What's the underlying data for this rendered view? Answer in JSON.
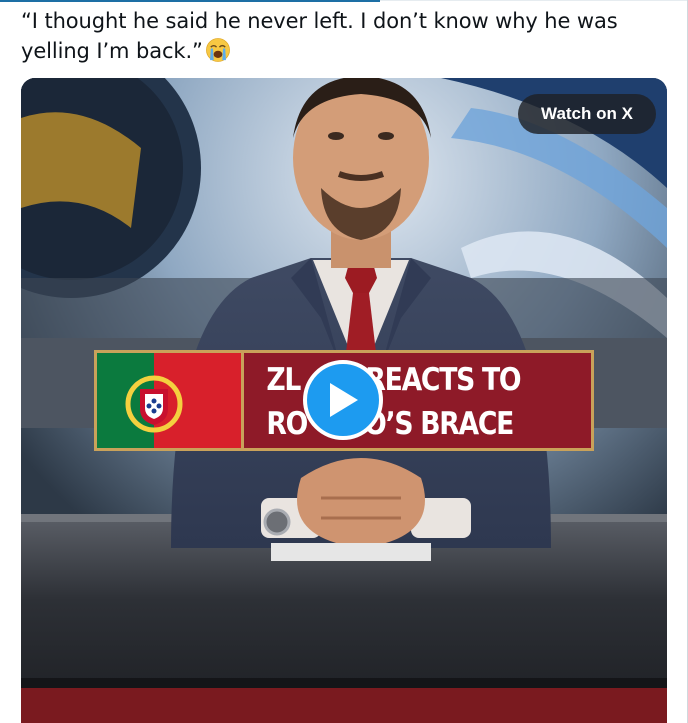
{
  "tweet": {
    "text": "“I thought he said he never left. I don’t know why he was yelling I’m back.”",
    "emoji": "loudly-crying-face-emoji"
  },
  "media": {
    "watch_label": "Watch on X",
    "banner_line1": "ZL         N REACTS TO",
    "banner_line2": "RO         DO’S BRACE",
    "flag": "portugal-flag",
    "play_icon": "play-icon"
  },
  "colors": {
    "play_button": "#1d9bf0",
    "banner_red": "#8e1a28",
    "banner_gold": "#c9a25a"
  }
}
